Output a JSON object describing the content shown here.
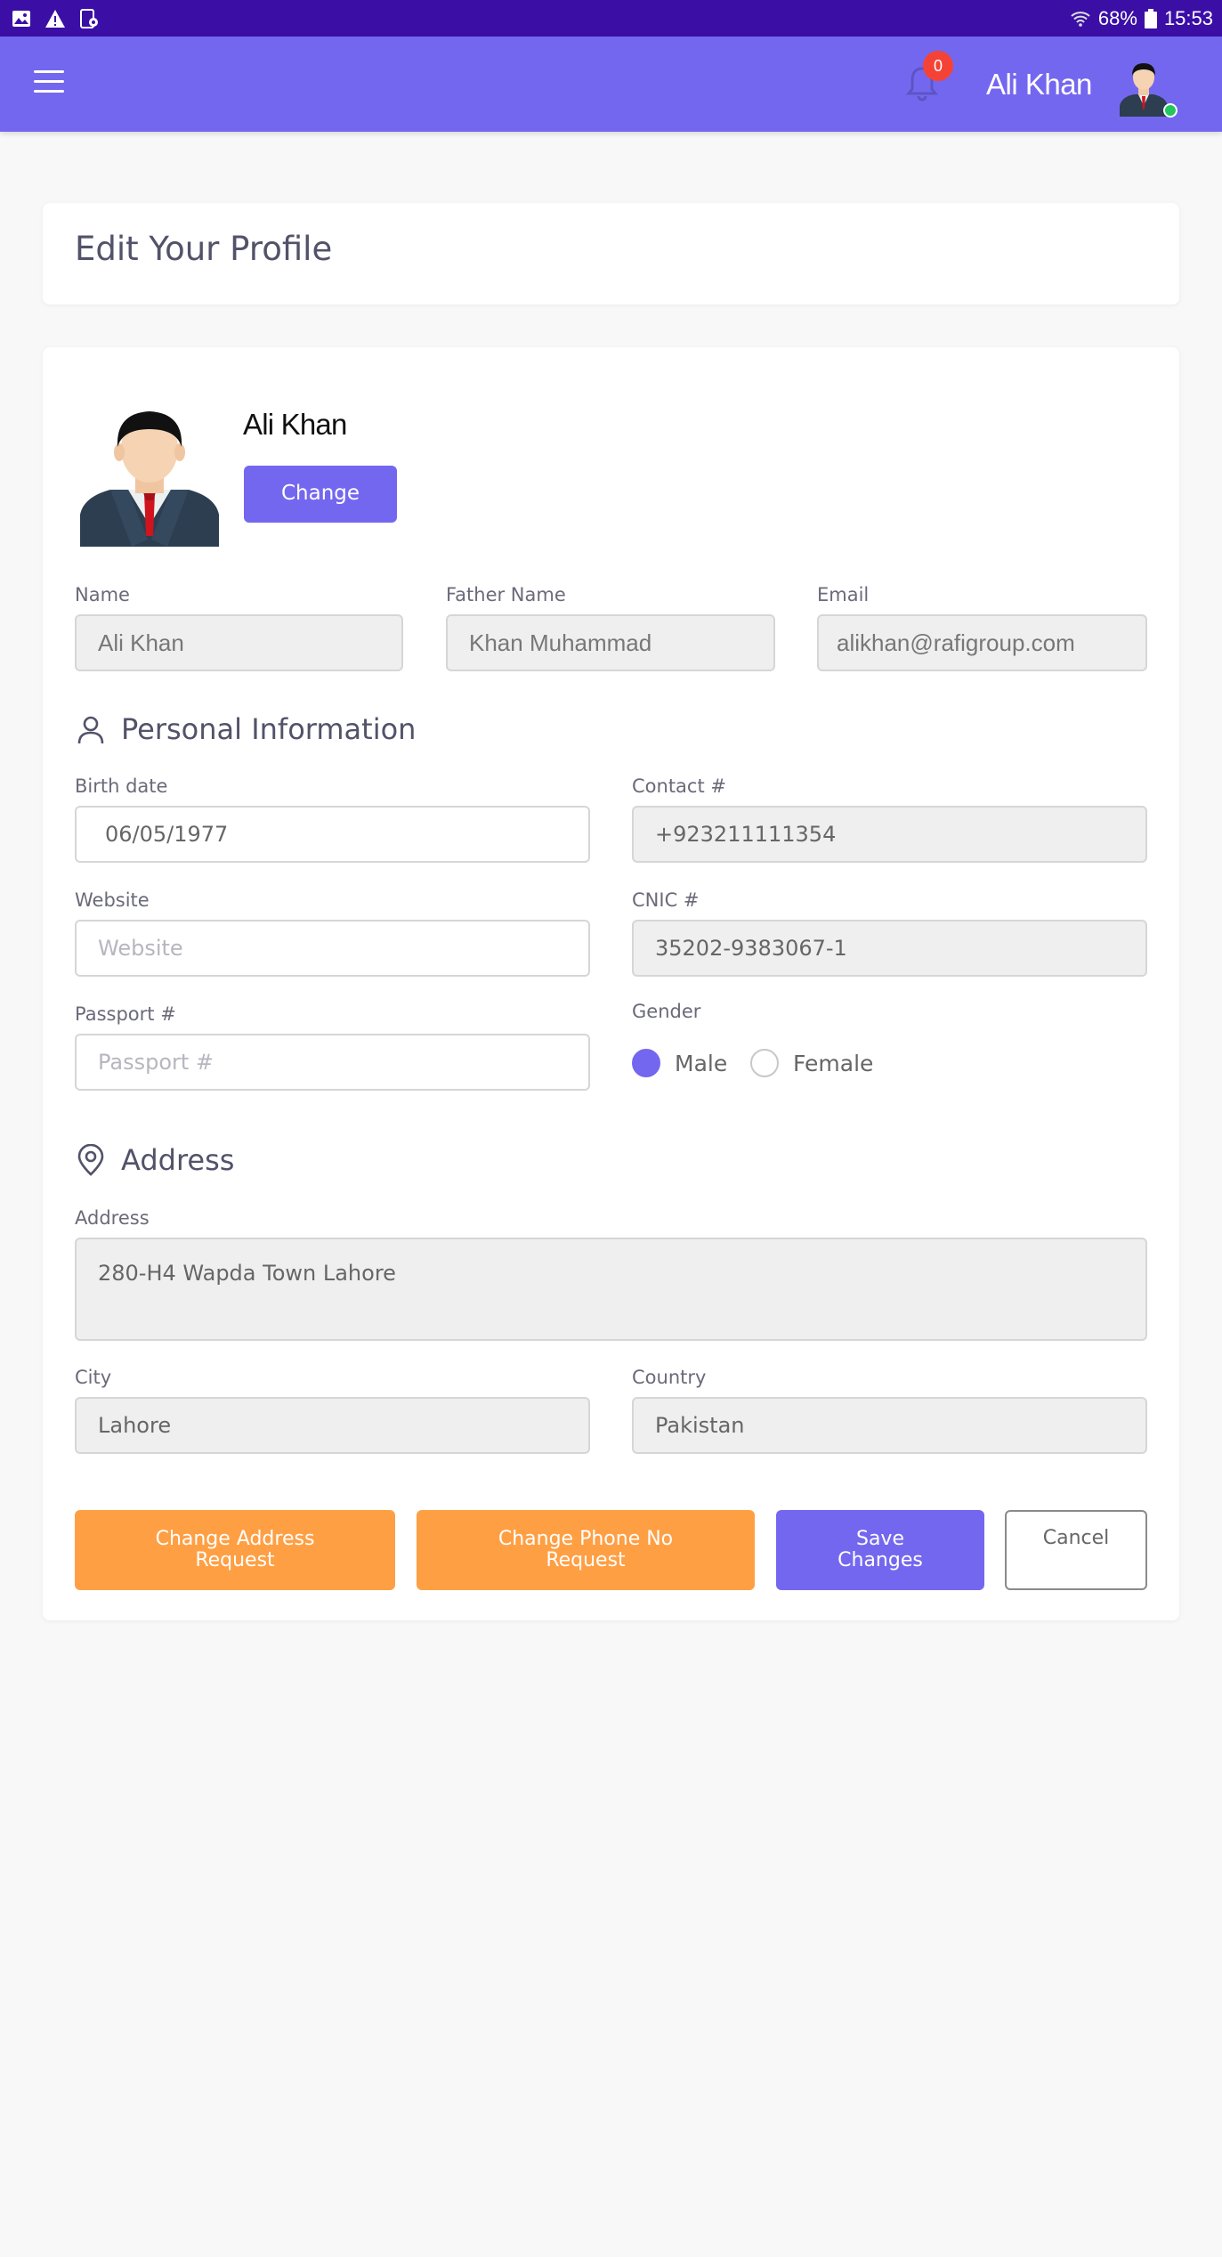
{
  "status_bar": {
    "battery": "68%",
    "time": "15:53"
  },
  "header": {
    "notification_count": "0",
    "user_name": "Ali Khan"
  },
  "page_title": "Edit Your Profile",
  "profile": {
    "name": "Ali Khan",
    "change_label": "Change"
  },
  "fields": {
    "name": {
      "label": "Name",
      "value": "Ali Khan"
    },
    "father_name": {
      "label": "Father Name",
      "value": "Khan Muhammad"
    },
    "email": {
      "label": "Email",
      "value": "alikhan@rafigroup.com"
    }
  },
  "personal": {
    "title": "Personal Information",
    "birth_date": {
      "label": "Birth date",
      "value": "06/05/1977"
    },
    "contact": {
      "label": "Contact #",
      "value": "+923211111354"
    },
    "website": {
      "label": "Website",
      "placeholder": "Website"
    },
    "cnic": {
      "label": "CNIC #",
      "value": "35202-9383067-1"
    },
    "passport": {
      "label": "Passport #",
      "placeholder": "Passport #"
    },
    "gender": {
      "label": "Gender",
      "options": [
        "Male",
        "Female"
      ],
      "selected": "Male"
    }
  },
  "address": {
    "title": "Address",
    "address": {
      "label": "Address",
      "value": "280-H4 Wapda Town Lahore"
    },
    "city": {
      "label": "City",
      "value": "Lahore"
    },
    "country": {
      "label": "Country",
      "value": "Pakistan"
    }
  },
  "actions": {
    "change_address": "Change Address Request",
    "change_phone": "Change Phone No Request",
    "save": "Save Changes",
    "cancel": "Cancel"
  },
  "colors": {
    "status_bar": "#3b0fa6",
    "primary": "#7467ef",
    "orange": "#ff9f43",
    "badge": "#f44336",
    "online": "#22c55e"
  }
}
